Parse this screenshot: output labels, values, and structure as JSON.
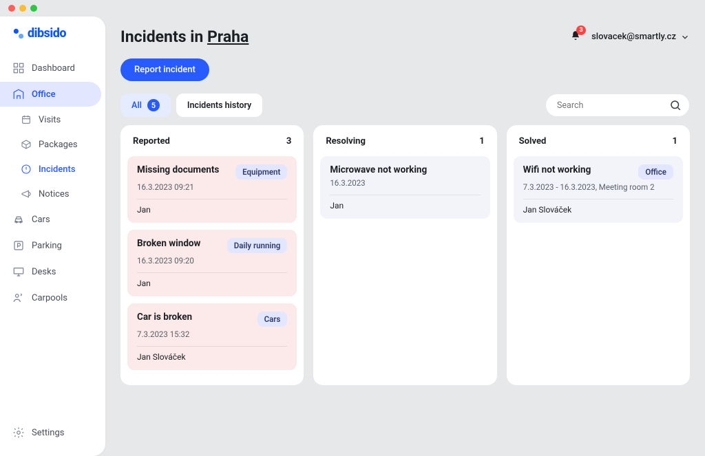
{
  "brand": "dibsido",
  "sidebar": {
    "items": [
      {
        "label": "Dashboard"
      },
      {
        "label": "Office"
      },
      {
        "label": "Visits"
      },
      {
        "label": "Packages"
      },
      {
        "label": "Incidents"
      },
      {
        "label": "Notices"
      },
      {
        "label": "Cars"
      },
      {
        "label": "Parking"
      },
      {
        "label": "Desks"
      },
      {
        "label": "Carpools"
      }
    ],
    "settings": "Settings"
  },
  "header": {
    "title_prefix": "Incidents in ",
    "city": "Praha",
    "notifications": "3",
    "user_email": "slovacek@smartly.cz"
  },
  "actions": {
    "report": "Report incident"
  },
  "tabs": {
    "all": "All",
    "all_count": "5",
    "history": "Incidents history"
  },
  "search": {
    "placeholder": "Search"
  },
  "columns": [
    {
      "title": "Reported",
      "count": "3",
      "variant": "reported",
      "cards": [
        {
          "title": "Missing documents",
          "tag": "Equipment",
          "meta": "16.3.2023 09:21",
          "assignee": "Jan"
        },
        {
          "title": "Broken window",
          "tag": "Daily running",
          "meta": "16.3.2023 09:20",
          "assignee": "Jan"
        },
        {
          "title": "Car is broken",
          "tag": "Cars",
          "meta": "7.3.2023 15:32",
          "assignee": "Jan Slováček"
        }
      ]
    },
    {
      "title": "Resolving",
      "count": "1",
      "variant": "resolving",
      "cards": [
        {
          "title": "Microwave not working",
          "tag": "",
          "meta": "16.3.2023",
          "assignee": "Jan"
        }
      ]
    },
    {
      "title": "Solved",
      "count": "1",
      "variant": "solved",
      "cards": [
        {
          "title": "Wifi not working",
          "tag": "Office",
          "meta": "7.3.2023 - 16.3.2023, Meeting room 2",
          "assignee": "Jan Slováček"
        }
      ]
    }
  ]
}
